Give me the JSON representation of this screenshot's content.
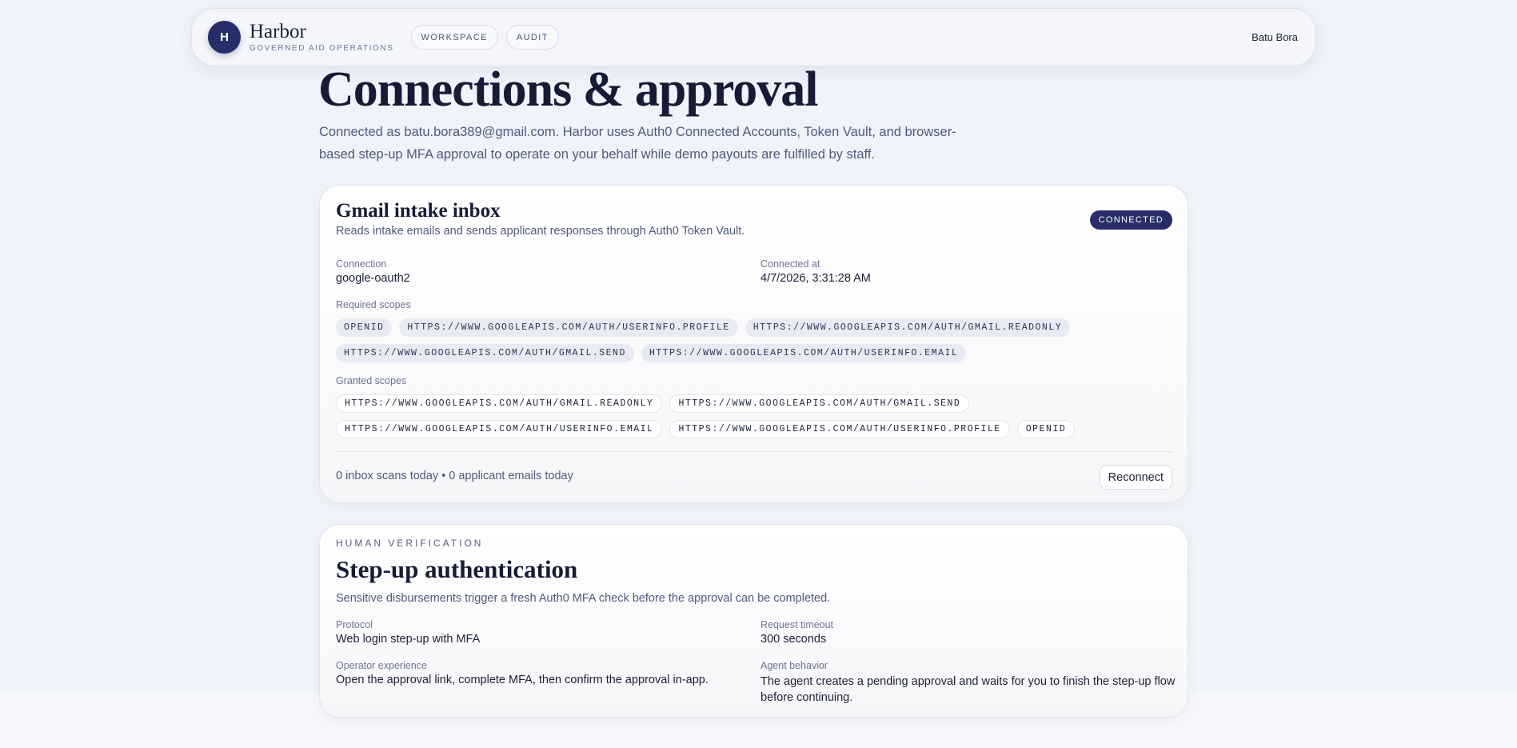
{
  "app": {
    "logo_letter": "H",
    "name": "Harbor",
    "tagline": "GOVERNED AID OPERATIONS",
    "nav": [
      "WORKSPACE",
      "AUDIT"
    ],
    "user": "Batu Bora"
  },
  "page": {
    "title": "Connections & approval",
    "intro": "Connected as batu.bora389@gmail.com. Harbor uses Auth0 Connected Accounts, Token Vault, and browser-based step-up MFA approval to operate on your behalf while demo payouts are fulfilled by staff."
  },
  "gmail_card": {
    "title": "Gmail intake inbox",
    "description": "Reads intake emails and sends applicant responses through Auth0 Token Vault.",
    "status": "CONNECTED",
    "connection_label": "Connection",
    "connection_value": "google-oauth2",
    "connected_at_label": "Connected at",
    "connected_at_value": "4/7/2026, 3:31:28 AM",
    "required_scopes_label": "Required scopes",
    "required_scopes": [
      "OPENID",
      "HTTPS://WWW.GOOGLEAPIS.COM/AUTH/USERINFO.PROFILE",
      "HTTPS://WWW.GOOGLEAPIS.COM/AUTH/GMAIL.READONLY",
      "HTTPS://WWW.GOOGLEAPIS.COM/AUTH/GMAIL.SEND",
      "HTTPS://WWW.GOOGLEAPIS.COM/AUTH/USERINFO.EMAIL"
    ],
    "granted_scopes_label": "Granted scopes",
    "granted_scopes": [
      "HTTPS://WWW.GOOGLEAPIS.COM/AUTH/GMAIL.READONLY",
      "HTTPS://WWW.GOOGLEAPIS.COM/AUTH/GMAIL.SEND",
      "HTTPS://WWW.GOOGLEAPIS.COM/AUTH/USERINFO.EMAIL",
      "HTTPS://WWW.GOOGLEAPIS.COM/AUTH/USERINFO.PROFILE",
      "OPENID"
    ],
    "stats": "0 inbox scans today • 0 applicant emails today",
    "reconnect_label": "Reconnect"
  },
  "stepup_card": {
    "eyebrow": "HUMAN VERIFICATION",
    "title": "Step-up authentication",
    "description": "Sensitive disbursements trigger a fresh Auth0 MFA check before the approval can be completed.",
    "protocol_label": "Protocol",
    "protocol_value": "Web login step-up with MFA",
    "timeout_label": "Request timeout",
    "timeout_value": "300 seconds",
    "operator_label": "Operator experience",
    "operator_value": "Open the approval link, complete MFA, then confirm the approval in-app.",
    "agent_label": "Agent behavior",
    "agent_value": "The agent creates a pending approval and waits for you to finish the step-up flow before continuing."
  }
}
